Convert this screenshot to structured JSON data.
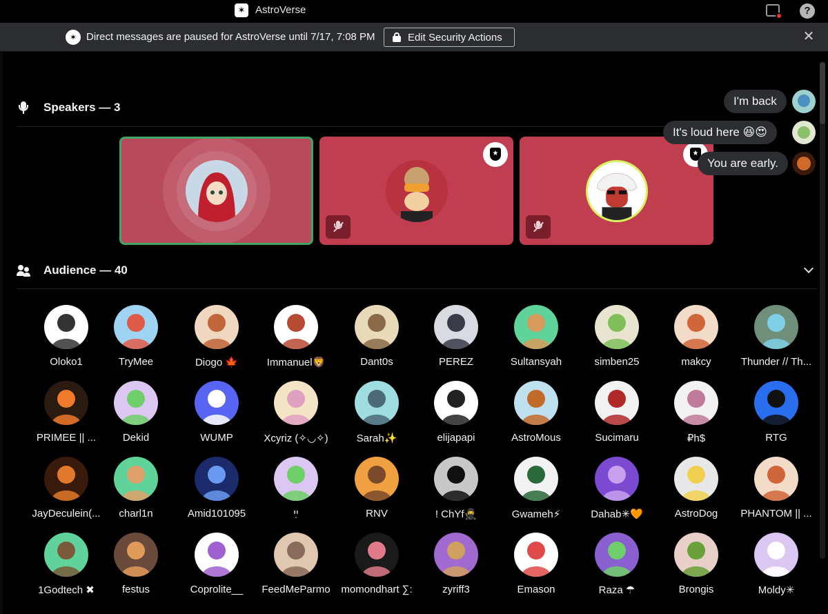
{
  "app": {
    "title": "AstroVerse",
    "icon": "astroverse-logo-icon"
  },
  "banner": {
    "message": "Direct messages are paused for AstroVerse until 7/17, 7:08 PM",
    "button_label": "Edit Security Actions",
    "icon": "astroverse-logo-icon",
    "close_icon": "close-icon"
  },
  "speakers": {
    "header": "Speakers — 3",
    "icon": "microphone-icon",
    "cards": [
      {
        "speaking": true,
        "moderator": false,
        "muted": false,
        "avatar_color": "#c9d8e6"
      },
      {
        "speaking": false,
        "moderator": true,
        "muted": true,
        "avatar_color": "#b8323f"
      },
      {
        "speaking": false,
        "moderator": true,
        "muted": true,
        "avatar_color": "#ffffff"
      }
    ]
  },
  "chat": [
    {
      "text": "I'm back"
    },
    {
      "text": "It's loud here 😆😍"
    },
    {
      "text": "You are early."
    }
  ],
  "audience": {
    "header": "Audience — 40",
    "icon": "people-icon",
    "collapse_icon": "chevron-down-icon",
    "members": [
      {
        "name": "Oloko1",
        "color": "#ffffff",
        "fg": "#333333"
      },
      {
        "name": "TryMee",
        "color": "#9fd3f2",
        "fg": "#e05a4a"
      },
      {
        "name": "Diogo 🍁",
        "color": "#f0d8c0",
        "fg": "#c0663a"
      },
      {
        "name": "Immanuel🦁",
        "color": "#ffffff",
        "fg": "#b64a32"
      },
      {
        "name": "Dant0s",
        "color": "#e8d9b8",
        "fg": "#8a6a48"
      },
      {
        "name": "PEREZ",
        "color": "#d8dce0",
        "fg": "#3a3a48"
      },
      {
        "name": "Sultansyah",
        "color": "#5fd39a",
        "fg": "#d69a5a"
      },
      {
        "name": "simben25",
        "color": "#e8e4d0",
        "fg": "#7fbf5a"
      },
      {
        "name": "makcy",
        "color": "#f2dcc8",
        "fg": "#d0653a"
      },
      {
        "name": "Thunder // Th...",
        "color": "#6f8f7a",
        "fg": "#7fd0e6"
      },
      {
        "name": "PRIMEE || ...",
        "color": "#2a1a10",
        "fg": "#f07a2a"
      },
      {
        "name": "Dekid",
        "color": "#dcc6f2",
        "fg": "#6fcf6a"
      },
      {
        "name": "WUMP",
        "color": "#5865f2",
        "fg": "#ffffff"
      },
      {
        "name": "Xcyriz (✧◡✧)",
        "color": "#f4e4c6",
        "fg": "#e0a0c0"
      },
      {
        "name": "Sarah✨",
        "color": "#9fdde0",
        "fg": "#4a6a78"
      },
      {
        "name": "elijapapi",
        "color": "#ffffff",
        "fg": "#222222"
      },
      {
        "name": "AstroMous",
        "color": "#bfe0ee",
        "fg": "#c26a2a"
      },
      {
        "name": "Sucimaru",
        "color": "#f2f2f2",
        "fg": "#b02a2a"
      },
      {
        "name": "₽h$",
        "color": "#f2f2f2",
        "fg": "#c07a9a"
      },
      {
        "name": "RTG",
        "color": "#2a6ef0",
        "fg": "#111111"
      },
      {
        "name": "JayDeculein(...",
        "color": "#3a1a0a",
        "fg": "#e07a2a"
      },
      {
        "name": "charl1n",
        "color": "#5fd39a",
        "fg": "#e0a06a"
      },
      {
        "name": "Amid101095",
        "color": "#1a2a6a",
        "fg": "#6a9af0"
      },
      {
        "name": "ײַ",
        "color": "#dcc6f2",
        "fg": "#6fcf6a"
      },
      {
        "name": "RNV",
        "color": "#f0a040",
        "fg": "#7a4a2a"
      },
      {
        "name": "! ChYf🥷",
        "color": "#c8c8c8",
        "fg": "#111111"
      },
      {
        "name": "Gwameh⚡",
        "color": "#f2f2f2",
        "fg": "#2a6a3a"
      },
      {
        "name": "Dahab✳🧡",
        "color": "#7a4ad0",
        "fg": "#c8a0f0"
      },
      {
        "name": "AstroDog",
        "color": "#e8e8e8",
        "fg": "#f0d050"
      },
      {
        "name": "PHANTOM || ...",
        "color": "#f2dcc8",
        "fg": "#d0653a"
      },
      {
        "name": "1Godtech ✖",
        "color": "#5fd39a",
        "fg": "#7a5a3a"
      },
      {
        "name": "festus",
        "color": "#6a4a3a",
        "fg": "#e09a5a"
      },
      {
        "name": "Coprolite__",
        "color": "#ffffff",
        "fg": "#a060d0"
      },
      {
        "name": "FeedMeParmo",
        "color": "#e0c8b0",
        "fg": "#8a6a5a"
      },
      {
        "name": "momondhart ∑:",
        "color": "#1a1a1a",
        "fg": "#e07a8a"
      },
      {
        "name": "zyriff3",
        "color": "#a06ad0",
        "fg": "#d0a060"
      },
      {
        "name": "Emason",
        "color": "#ffffff",
        "fg": "#e04a4a"
      },
      {
        "name": "Raza ☂",
        "color": "#8a60d0",
        "fg": "#6fcf6a"
      },
      {
        "name": "Brongis",
        "color": "#e8d0c8",
        "fg": "#6aa03a"
      },
      {
        "name": "Moldy✳",
        "color": "#dcc6f2",
        "fg": "#ffffff"
      }
    ]
  }
}
